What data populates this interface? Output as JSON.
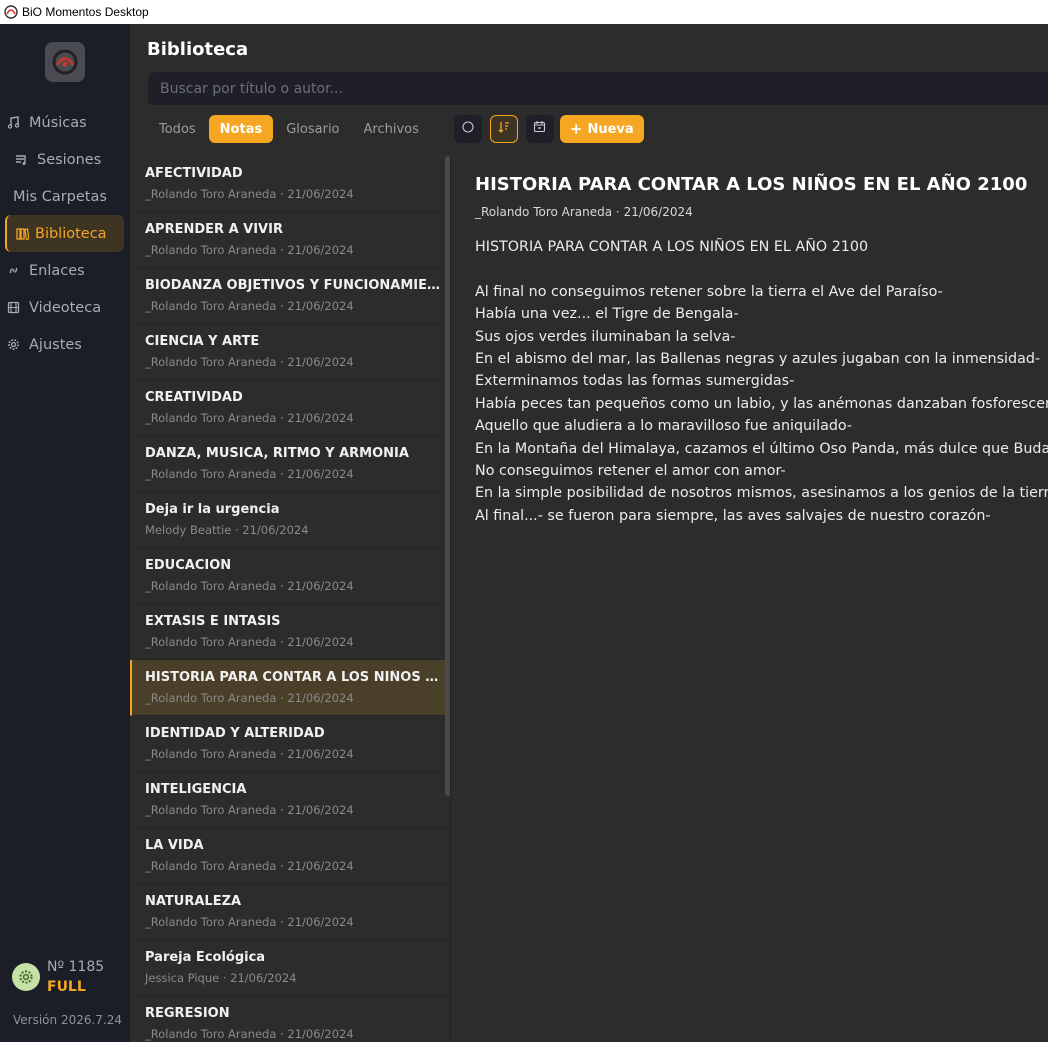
{
  "window": {
    "title": "BiO Momentos Desktop"
  },
  "sidebar": {
    "items": [
      {
        "label": "Músicas",
        "icon": "music-note-icon"
      },
      {
        "label": "Sesiones",
        "icon": "playlist-icon"
      },
      {
        "label": "Mis Carpetas",
        "icon": ""
      },
      {
        "label": "Biblioteca",
        "icon": "books-icon",
        "active": true
      },
      {
        "label": "Enlaces",
        "icon": "link-icon"
      },
      {
        "label": "Videoteca",
        "icon": "film-icon"
      },
      {
        "label": "Ajustes",
        "icon": "gear-icon"
      }
    ],
    "account": {
      "number": "Nº 1185",
      "plan": "FULL"
    },
    "version": "Versión 2026.7.24"
  },
  "main": {
    "title": "Biblioteca",
    "search_placeholder": "Buscar por título o autor...",
    "tabs": [
      "Todos",
      "Notas",
      "Glosario",
      "Archivos"
    ],
    "active_tab": "Notas",
    "new_button": "Nueva"
  },
  "notes": [
    {
      "title": "AFECTIVIDAD",
      "meta": "_Rolando Toro Araneda · 21/06/2024"
    },
    {
      "title": "APRENDER A VIVIR",
      "meta": "_Rolando Toro Araneda · 21/06/2024"
    },
    {
      "title": "BIODANZA OBJETIVOS Y FUNCIONAMIENTO",
      "meta": "_Rolando Toro Araneda · 21/06/2024"
    },
    {
      "title": "CIENCIA Y ARTE",
      "meta": "_Rolando Toro Araneda · 21/06/2024"
    },
    {
      "title": "CREATIVIDAD",
      "meta": "_Rolando Toro Araneda · 21/06/2024"
    },
    {
      "title": "DANZA, MUSICA, RITMO Y ARMONIA",
      "meta": "_Rolando Toro Araneda · 21/06/2024"
    },
    {
      "title": "Deja ir la urgencia",
      "meta": "Melody Beattie · 21/06/2024"
    },
    {
      "title": "EDUCACION",
      "meta": "_Rolando Toro Araneda · 21/06/2024"
    },
    {
      "title": "EXTASIS E INTASIS",
      "meta": "_Rolando Toro Araneda · 21/06/2024"
    },
    {
      "title": "HISTORIA PARA CONTAR A LOS NIÑOS EN E...",
      "meta": "_Rolando Toro Araneda · 21/06/2024",
      "selected": true
    },
    {
      "title": "IDENTIDAD Y ALTERIDAD",
      "meta": "_Rolando Toro Araneda · 21/06/2024"
    },
    {
      "title": "INTELIGENCIA",
      "meta": "_Rolando Toro Araneda · 21/06/2024"
    },
    {
      "title": "LA VIDA",
      "meta": "_Rolando Toro Araneda · 21/06/2024"
    },
    {
      "title": "NATURALEZA",
      "meta": "_Rolando Toro Araneda · 21/06/2024"
    },
    {
      "title": "Pareja Ecológica",
      "meta": "Jessica Pique · 21/06/2024"
    },
    {
      "title": "REGRESION",
      "meta": "_Rolando Toro Araneda · 21/06/2024"
    }
  ],
  "detail": {
    "title": "HISTORIA PARA CONTAR A LOS NIÑOS EN EL AÑO 2100",
    "meta": "_Rolando Toro Araneda · 21/06/2024",
    "lines": [
      "HISTORIA PARA CONTAR A LOS NIÑOS EN EL AÑO 2100",
      "",
      "Al final no conseguimos retener sobre la tierra el Ave del Paraíso-",
      "Había una vez... el Tigre de Bengala-",
      "Sus ojos verdes iluminaban la selva-",
      "En el abismo del mar, las Ballenas negras y azules jugaban con la inmensidad-",
      "Exterminamos todas las formas sumergidas-",
      "Había peces tan pequeños como un labio, y las anémonas danzaban fosforescentes-",
      "Aquello que aludiera a lo maravilloso fue aniquilado-",
      "En la Montaña del Himalaya, cazamos el último Oso Panda, más dulce que Buda-",
      "No conseguimos retener el amor con amor-",
      "En la simple posibilidad de nosotros mismos, asesinamos a los genios de la tierra-",
      "Al final...- se fueron para siempre, las aves salvajes de nuestro corazón-"
    ]
  },
  "colors": {
    "accent": "#f5a623",
    "sidebar": "#1b1d27",
    "panel": "#2c2c2c"
  }
}
